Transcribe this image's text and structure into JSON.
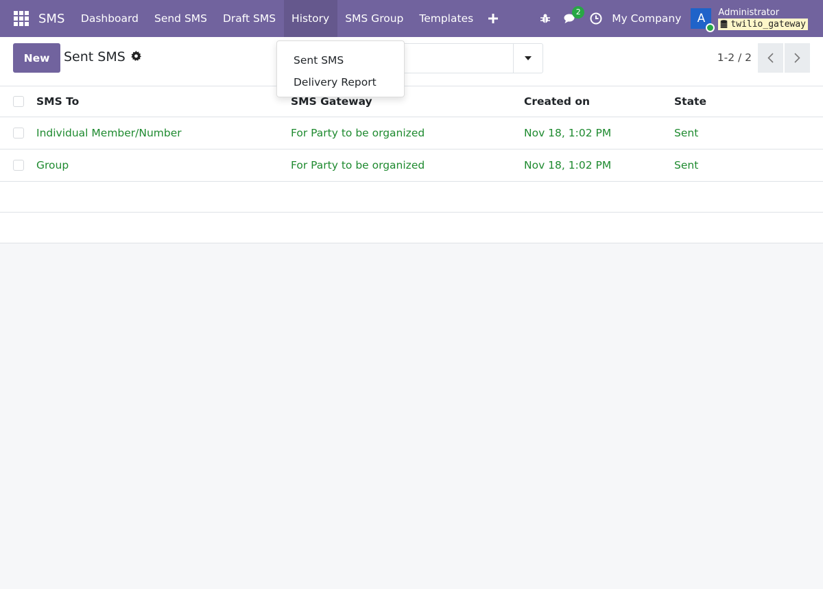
{
  "navbar": {
    "brand": "SMS",
    "menu": [
      "Dashboard",
      "Send SMS",
      "Draft SMS",
      "History",
      "SMS Group",
      "Templates"
    ],
    "chat_count": "2",
    "company": "My Company",
    "avatar_letter": "A",
    "user_name": "Administrator",
    "database": "twilio_gateway"
  },
  "control": {
    "new_label": "New",
    "breadcrumb": "Sent SMS",
    "pager": "1-2 / 2"
  },
  "dropdown": {
    "items": [
      "Sent SMS",
      "Delivery Report"
    ]
  },
  "table": {
    "headers": [
      "SMS To",
      "SMS Gateway",
      "Created on",
      "State"
    ],
    "rows": [
      [
        "Individual Member/Number",
        "For Party to be organized",
        "Nov 18, 1:02 PM",
        "Sent"
      ],
      [
        "Group",
        "For Party to be organized",
        "Nov 18, 1:02 PM",
        "Sent"
      ]
    ]
  },
  "colors": {
    "primary": "#71639e",
    "link_green": "#1e8a2f",
    "badge_green": "#28a745"
  },
  "icons": [
    "apps-grid-icon",
    "plus-icon",
    "bug-icon",
    "chat-icon",
    "clock-icon",
    "database-icon",
    "gear-icon",
    "caret-down-icon",
    "chevron-left-icon",
    "chevron-right-icon"
  ]
}
